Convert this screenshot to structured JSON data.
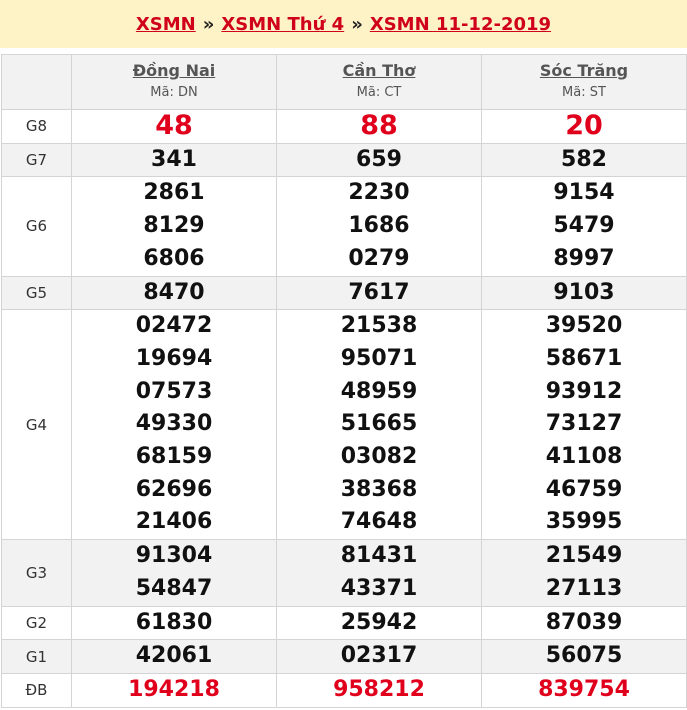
{
  "breadcrumb": {
    "items": [
      "XSMN",
      "XSMN Thứ 4",
      "XSMN 11-12-2019"
    ],
    "separator": "»"
  },
  "provinces": [
    {
      "name": "Đồng Nai",
      "code": "Mã: DN"
    },
    {
      "name": "Cần Thơ",
      "code": "Mã: CT"
    },
    {
      "name": "Sóc Trăng",
      "code": "Mã: ST"
    }
  ],
  "prizes": [
    {
      "label": "G8",
      "values": [
        [
          "48"
        ],
        [
          "88"
        ],
        [
          "20"
        ]
      ]
    },
    {
      "label": "G7",
      "values": [
        [
          "341"
        ],
        [
          "659"
        ],
        [
          "582"
        ]
      ]
    },
    {
      "label": "G6",
      "values": [
        [
          "2861",
          "8129",
          "6806"
        ],
        [
          "2230",
          "1686",
          "0279"
        ],
        [
          "9154",
          "5479",
          "8997"
        ]
      ]
    },
    {
      "label": "G5",
      "values": [
        [
          "8470"
        ],
        [
          "7617"
        ],
        [
          "9103"
        ]
      ]
    },
    {
      "label": "G4",
      "values": [
        [
          "02472",
          "19694",
          "07573",
          "49330",
          "68159",
          "62696",
          "21406"
        ],
        [
          "21538",
          "95071",
          "48959",
          "51665",
          "03082",
          "38368",
          "74648"
        ],
        [
          "39520",
          "58671",
          "93912",
          "73127",
          "41108",
          "46759",
          "35995"
        ]
      ]
    },
    {
      "label": "G3",
      "values": [
        [
          "91304",
          "54847"
        ],
        [
          "81431",
          "43371"
        ],
        [
          "21549",
          "27113"
        ]
      ]
    },
    {
      "label": "G2",
      "values": [
        [
          "61830"
        ],
        [
          "25942"
        ],
        [
          "87039"
        ]
      ]
    },
    {
      "label": "G1",
      "values": [
        [
          "42061"
        ],
        [
          "02317"
        ],
        [
          "56075"
        ]
      ]
    },
    {
      "label": "ĐB",
      "values": [
        [
          "194218"
        ],
        [
          "958212"
        ],
        [
          "839754"
        ]
      ]
    }
  ],
  "colors": {
    "accent_red": "#e0001b",
    "header_bg": "#fdf3c6",
    "alt_row_bg": "#f2f2f2"
  }
}
